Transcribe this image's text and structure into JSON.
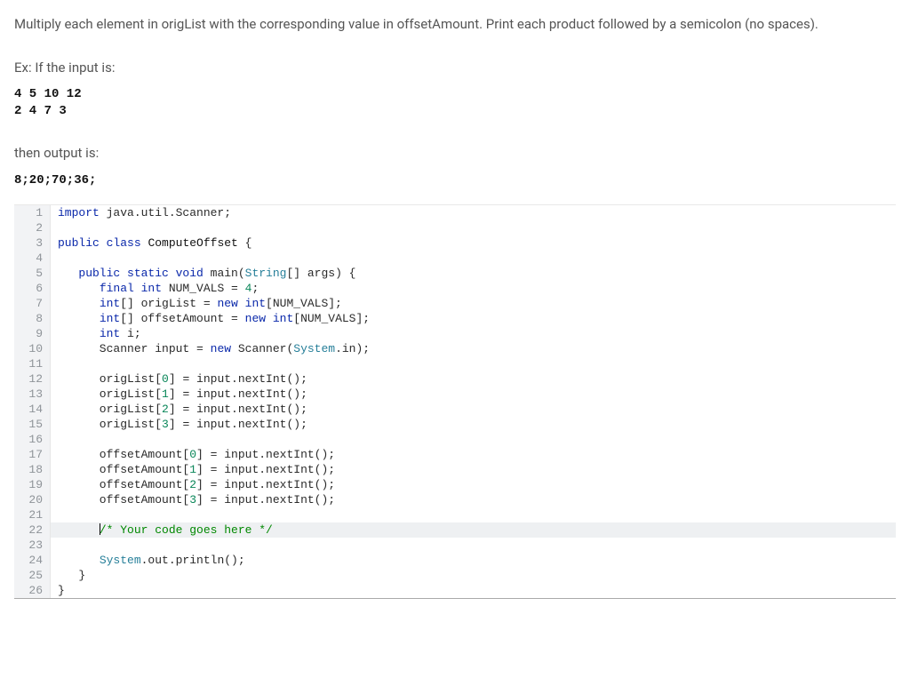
{
  "prompt": {
    "instructions": "Multiply each element in origList with the corresponding value in offsetAmount. Print each product followed by a semicolon (no spaces).",
    "example_label": "Ex: If the input is:",
    "example_input": "4 5 10 12\n2 4 7 3",
    "then_label": "then output is:",
    "example_output": "8;20;70;36;"
  },
  "code": {
    "highlight_line": 22,
    "lines": [
      {
        "n": 1,
        "tokens": [
          {
            "t": "import",
            "c": "kw"
          },
          {
            "t": " java.util.Scanner;",
            "c": ""
          }
        ]
      },
      {
        "n": 2,
        "tokens": [
          {
            "t": "",
            "c": ""
          }
        ]
      },
      {
        "n": 3,
        "tokens": [
          {
            "t": "public class",
            "c": "kw"
          },
          {
            "t": " ",
            "c": ""
          },
          {
            "t": "ComputeOffset",
            "c": "classname"
          },
          {
            "t": " {",
            "c": ""
          }
        ]
      },
      {
        "n": 4,
        "tokens": [
          {
            "t": "",
            "c": ""
          }
        ]
      },
      {
        "n": 5,
        "tokens": [
          {
            "t": "   ",
            "c": ""
          },
          {
            "t": "public static void",
            "c": "kw"
          },
          {
            "t": " main(",
            "c": ""
          },
          {
            "t": "String",
            "c": "type"
          },
          {
            "t": "[] args) {",
            "c": ""
          }
        ]
      },
      {
        "n": 6,
        "tokens": [
          {
            "t": "      ",
            "c": ""
          },
          {
            "t": "final int",
            "c": "kw"
          },
          {
            "t": " NUM_VALS = ",
            "c": ""
          },
          {
            "t": "4",
            "c": "num"
          },
          {
            "t": ";",
            "c": ""
          }
        ]
      },
      {
        "n": 7,
        "tokens": [
          {
            "t": "      ",
            "c": ""
          },
          {
            "t": "int",
            "c": "kw"
          },
          {
            "t": "[] origList = ",
            "c": ""
          },
          {
            "t": "new int",
            "c": "kw"
          },
          {
            "t": "[NUM_VALS];",
            "c": ""
          }
        ]
      },
      {
        "n": 8,
        "tokens": [
          {
            "t": "      ",
            "c": ""
          },
          {
            "t": "int",
            "c": "kw"
          },
          {
            "t": "[] offsetAmount = ",
            "c": ""
          },
          {
            "t": "new int",
            "c": "kw"
          },
          {
            "t": "[NUM_VALS];",
            "c": ""
          }
        ]
      },
      {
        "n": 9,
        "tokens": [
          {
            "t": "      ",
            "c": ""
          },
          {
            "t": "int",
            "c": "kw"
          },
          {
            "t": " i;",
            "c": ""
          }
        ]
      },
      {
        "n": 10,
        "tokens": [
          {
            "t": "      Scanner input = ",
            "c": ""
          },
          {
            "t": "new",
            "c": "kw"
          },
          {
            "t": " Scanner(",
            "c": ""
          },
          {
            "t": "System",
            "c": "type"
          },
          {
            "t": ".in);",
            "c": ""
          }
        ]
      },
      {
        "n": 11,
        "tokens": [
          {
            "t": "",
            "c": ""
          }
        ]
      },
      {
        "n": 12,
        "tokens": [
          {
            "t": "      origList[",
            "c": ""
          },
          {
            "t": "0",
            "c": "num"
          },
          {
            "t": "] = input.nextInt();",
            "c": ""
          }
        ]
      },
      {
        "n": 13,
        "tokens": [
          {
            "t": "      origList[",
            "c": ""
          },
          {
            "t": "1",
            "c": "num"
          },
          {
            "t": "] = input.nextInt();",
            "c": ""
          }
        ]
      },
      {
        "n": 14,
        "tokens": [
          {
            "t": "      origList[",
            "c": ""
          },
          {
            "t": "2",
            "c": "num"
          },
          {
            "t": "] = input.nextInt();",
            "c": ""
          }
        ]
      },
      {
        "n": 15,
        "tokens": [
          {
            "t": "      origList[",
            "c": ""
          },
          {
            "t": "3",
            "c": "num"
          },
          {
            "t": "] = input.nextInt();",
            "c": ""
          }
        ]
      },
      {
        "n": 16,
        "tokens": [
          {
            "t": "",
            "c": ""
          }
        ]
      },
      {
        "n": 17,
        "tokens": [
          {
            "t": "      offsetAmount[",
            "c": ""
          },
          {
            "t": "0",
            "c": "num"
          },
          {
            "t": "] = input.nextInt();",
            "c": ""
          }
        ]
      },
      {
        "n": 18,
        "tokens": [
          {
            "t": "      offsetAmount[",
            "c": ""
          },
          {
            "t": "1",
            "c": "num"
          },
          {
            "t": "] = input.nextInt();",
            "c": ""
          }
        ]
      },
      {
        "n": 19,
        "tokens": [
          {
            "t": "      offsetAmount[",
            "c": ""
          },
          {
            "t": "2",
            "c": "num"
          },
          {
            "t": "] = input.nextInt();",
            "c": ""
          }
        ]
      },
      {
        "n": 20,
        "tokens": [
          {
            "t": "      offsetAmount[",
            "c": ""
          },
          {
            "t": "3",
            "c": "num"
          },
          {
            "t": "] = input.nextInt();",
            "c": ""
          }
        ]
      },
      {
        "n": 21,
        "tokens": [
          {
            "t": "",
            "c": ""
          }
        ]
      },
      {
        "n": 22,
        "tokens": [
          {
            "t": "      ",
            "c": ""
          },
          {
            "t": "|cursor|",
            "c": "cursor"
          },
          {
            "t": "/* Your code goes here */",
            "c": "comment"
          }
        ]
      },
      {
        "n": 23,
        "tokens": [
          {
            "t": "",
            "c": ""
          }
        ]
      },
      {
        "n": 24,
        "tokens": [
          {
            "t": "      ",
            "c": ""
          },
          {
            "t": "System",
            "c": "type"
          },
          {
            "t": ".out.println();",
            "c": ""
          }
        ]
      },
      {
        "n": 25,
        "tokens": [
          {
            "t": "   }",
            "c": ""
          }
        ]
      },
      {
        "n": 26,
        "tokens": [
          {
            "t": "}",
            "c": ""
          }
        ]
      }
    ]
  }
}
